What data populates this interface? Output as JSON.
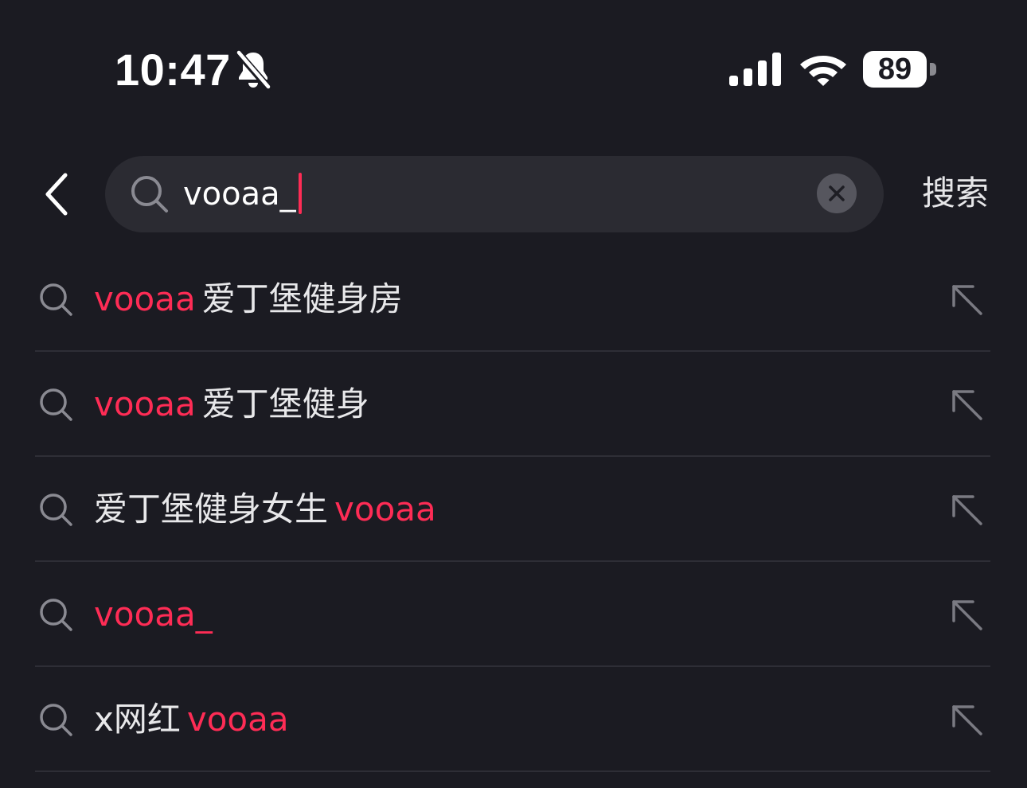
{
  "status_bar": {
    "time": "10:47",
    "battery_level": "89",
    "icons": [
      "bell-slash-icon",
      "cellular-signal-icon",
      "wifi-icon",
      "battery-icon"
    ]
  },
  "header": {
    "back_icon": "chevron-left-icon",
    "search": {
      "icon": "search-icon",
      "value": "vooaa_",
      "clear_icon": "close-circle-icon"
    },
    "search_button_label": "搜索"
  },
  "colors": {
    "background": "#1b1b22",
    "search_box": "#2b2b32",
    "highlight": "#fe2c55",
    "text": "#e8e8ea",
    "icon_gray": "#8a8a92",
    "divider": "#2e2e36"
  },
  "suggestions": [
    {
      "segments": [
        {
          "text": "vooaa",
          "highlight": true
        },
        {
          "text": "爱丁堡健身房",
          "highlight": false
        }
      ]
    },
    {
      "segments": [
        {
          "text": "vooaa",
          "highlight": true
        },
        {
          "text": "爱丁堡健身",
          "highlight": false
        }
      ]
    },
    {
      "segments": [
        {
          "text": "爱丁堡健身女生",
          "highlight": false
        },
        {
          "text": "vooaa",
          "highlight": true
        }
      ]
    },
    {
      "segments": [
        {
          "text": "vooaa_",
          "highlight": true
        }
      ]
    },
    {
      "segments": [
        {
          "text": "x网红",
          "highlight": false
        },
        {
          "text": "vooaa",
          "highlight": true
        }
      ]
    }
  ],
  "row_icons": {
    "leading": "search-icon",
    "trailing": "arrow-up-left-icon"
  }
}
